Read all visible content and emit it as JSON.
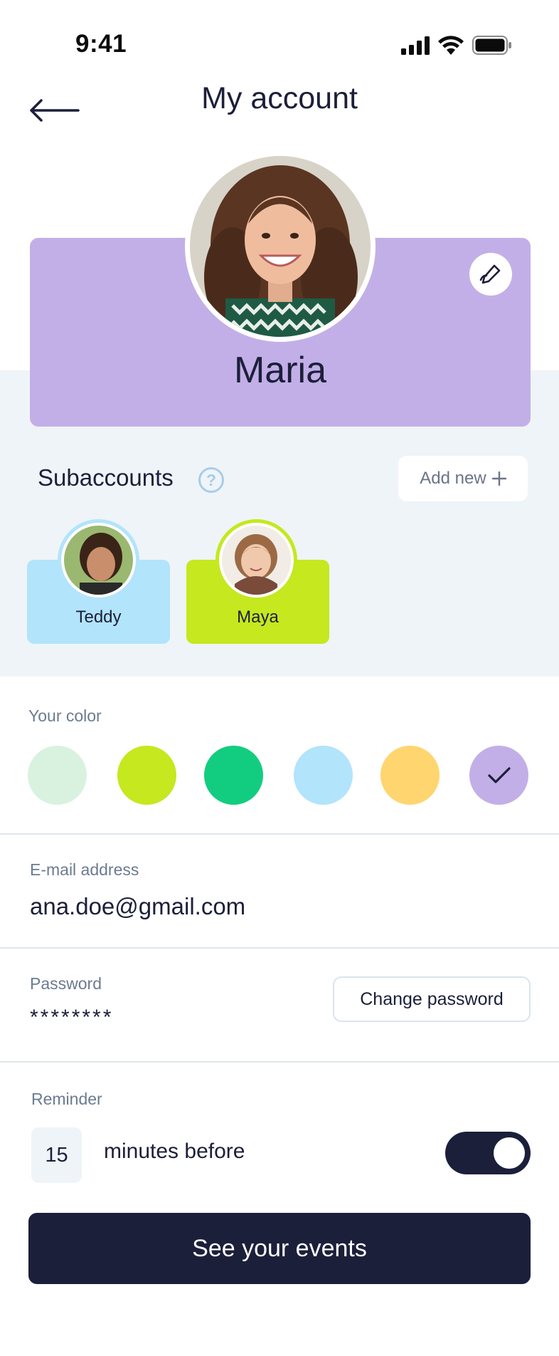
{
  "status_bar": {
    "time": "9:41",
    "icons": [
      "signal-icon",
      "wifi-icon",
      "battery-icon"
    ]
  },
  "header": {
    "title": "My account",
    "back_icon": "arrow-left-icon"
  },
  "profile": {
    "name": "Maria",
    "card_color": "#c2afe7",
    "edit_icon": "pencil-icon"
  },
  "subaccounts": {
    "title": "Subaccounts",
    "help_icon": "question-icon",
    "help_glyph": "?",
    "add_label": "Add new",
    "add_icon": "plus-icon",
    "items": [
      {
        "name": "Teddy",
        "color": "#b2e4fb"
      },
      {
        "name": "Maya",
        "color": "#c5e81f"
      }
    ]
  },
  "color_picker": {
    "label": "Your color",
    "colors": [
      "#d9f2df",
      "#c5e81f",
      "#12cd80",
      "#b2e4fb",
      "#ffd570",
      "#c2afe7"
    ],
    "selected_color": "#c2afe7",
    "selected_icon": "check-icon"
  },
  "email": {
    "label": "E-mail address",
    "value": "ana.doe@gmail.com"
  },
  "password": {
    "label": "Password",
    "value": "********",
    "change_label": "Change password"
  },
  "reminder": {
    "label": "Reminder",
    "minutes": "15",
    "unit_text": "minutes before",
    "enabled": true
  },
  "cta": {
    "label": "See your events"
  }
}
